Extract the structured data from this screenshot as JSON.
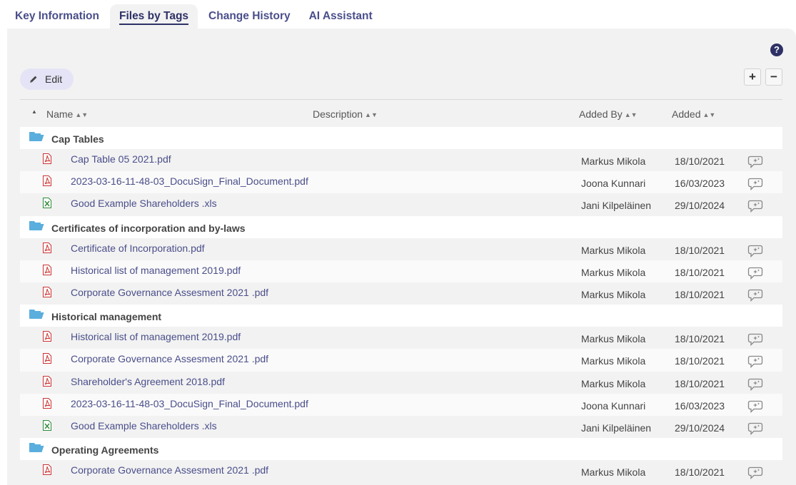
{
  "tabs": [
    {
      "label": "Key Information"
    },
    {
      "label": "Files by Tags"
    },
    {
      "label": "Change History"
    },
    {
      "label": "AI Assistant"
    }
  ],
  "toolbar": {
    "edit_label": "Edit",
    "help_symbol": "?",
    "expand_symbol": "+",
    "collapse_symbol": "−"
  },
  "columns": {
    "name": "Name",
    "description": "Description",
    "added_by": "Added By",
    "added": "Added"
  },
  "groups": [
    {
      "name": "Cap Tables",
      "files": [
        {
          "name": "Cap Table 05 2021.pdf",
          "type": "pdf",
          "added_by": "Markus Mikola",
          "added": "18/10/2021"
        },
        {
          "name": "2023-03-16-11-48-03_DocuSign_Final_Document.pdf",
          "type": "pdf",
          "added_by": "Joona Kunnari",
          "added": "16/03/2023"
        },
        {
          "name": "Good Example Shareholders .xls",
          "type": "xls",
          "added_by": "Jani Kilpeläinen",
          "added": "29/10/2024"
        }
      ]
    },
    {
      "name": "Certificates of incorporation and by-laws",
      "files": [
        {
          "name": "Certificate of Incorporation.pdf",
          "type": "pdf",
          "added_by": "Markus Mikola",
          "added": "18/10/2021"
        },
        {
          "name": "Historical list of management 2019.pdf",
          "type": "pdf",
          "added_by": "Markus Mikola",
          "added": "18/10/2021"
        },
        {
          "name": "Corporate Governance Assesment 2021 .pdf",
          "type": "pdf",
          "added_by": "Markus Mikola",
          "added": "18/10/2021"
        }
      ]
    },
    {
      "name": "Historical management",
      "files": [
        {
          "name": "Historical list of management 2019.pdf",
          "type": "pdf",
          "added_by": "Markus Mikola",
          "added": "18/10/2021"
        },
        {
          "name": "Corporate Governance Assesment 2021 .pdf",
          "type": "pdf",
          "added_by": "Markus Mikola",
          "added": "18/10/2021"
        },
        {
          "name": "Shareholder's Agreement 2018.pdf",
          "type": "pdf",
          "added_by": "Markus Mikola",
          "added": "18/10/2021"
        },
        {
          "name": "2023-03-16-11-48-03_DocuSign_Final_Document.pdf",
          "type": "pdf",
          "added_by": "Joona Kunnari",
          "added": "16/03/2023"
        },
        {
          "name": "Good Example Shareholders .xls",
          "type": "xls",
          "added_by": "Jani Kilpeläinen",
          "added": "29/10/2024"
        }
      ]
    },
    {
      "name": "Operating Agreements",
      "files": [
        {
          "name": "Corporate Governance Assesment 2021 .pdf",
          "type": "pdf",
          "added_by": "Markus Mikola",
          "added": "18/10/2021"
        }
      ]
    }
  ],
  "colors": {
    "accent": "#4a4e8a",
    "tab_active": "#2e3166",
    "folder": "#5aaedd",
    "pdf": "#cc3333",
    "xls": "#2e8b3a"
  },
  "icons": {
    "edit": "pencil-icon",
    "help": "help-icon",
    "folder": "folder-open-icon",
    "pdf": "pdf-file-icon",
    "xls": "excel-file-icon",
    "comment": "ai-chat-icon"
  }
}
